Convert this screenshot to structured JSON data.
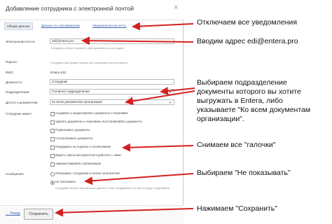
{
  "dialog": {
    "title": "Добавление сотрудника с электронной почтой",
    "close": "×",
    "tabs": [
      "Общие данные",
      "Данные по сертификатам",
      "Уведомления на почту"
    ],
    "fields": {
      "email_label": "Электронная почта:",
      "email_value": "edi@entera.pro",
      "email_hint": "Сотрудник получит письмо с приглашением на этот адрес",
      "password_label": "Пароль:",
      "password_hint": "Сотрудник сам укажет пароль при активации учетной записи",
      "fio_label": "ФИО:",
      "fio_value": "Entera EDI",
      "position_label": "Должность:",
      "position_value": "Сотрудник",
      "department_label": "Подразделение:",
      "department_value": "Головное подразделение",
      "access_label": "Доступ к документам:",
      "access_value": "Ко всем документам организации",
      "can_label": "Сотрудник может:",
      "permissions": [
        "Создавать и редактировать документы и черновики",
        "Удалять документы и черновики, восстанавливать документы",
        "Подписывать документы",
        "Согласовывать документы",
        "Передавать на подпись и согласование",
        "Видеть список контрагентов и работать с ними",
        "Администрировать организацию"
      ],
      "messages_label": "Сообщения:",
      "messages_options": [
        "Показывать сотрудника в списке получателей",
        "Не показывать"
      ],
      "messages_hint": "Сотрудник сможет сам написать диалог с этим сотрудником, но ему не будут предложены"
    },
    "footer": {
      "back": "← Назад",
      "save": "Сохранить"
    }
  },
  "annotations": {
    "a1": "Отключаем все уведомления",
    "a2": "Вводим адрес edi@entera.pro",
    "a3": [
      "Выбираем подразделение",
      "документы которого вы хотите",
      "выгружать в Entera, либо",
      "указываете \"Ко всем документам",
      "организации\"."
    ],
    "a4": "Снимаем все \"галочки\"",
    "a5": "Выбираем \"Не показывать\"",
    "a6": "Нажимаем \"Сохранить\""
  },
  "colors": {
    "arrow": "#d42020",
    "link": "#3a66b3"
  }
}
